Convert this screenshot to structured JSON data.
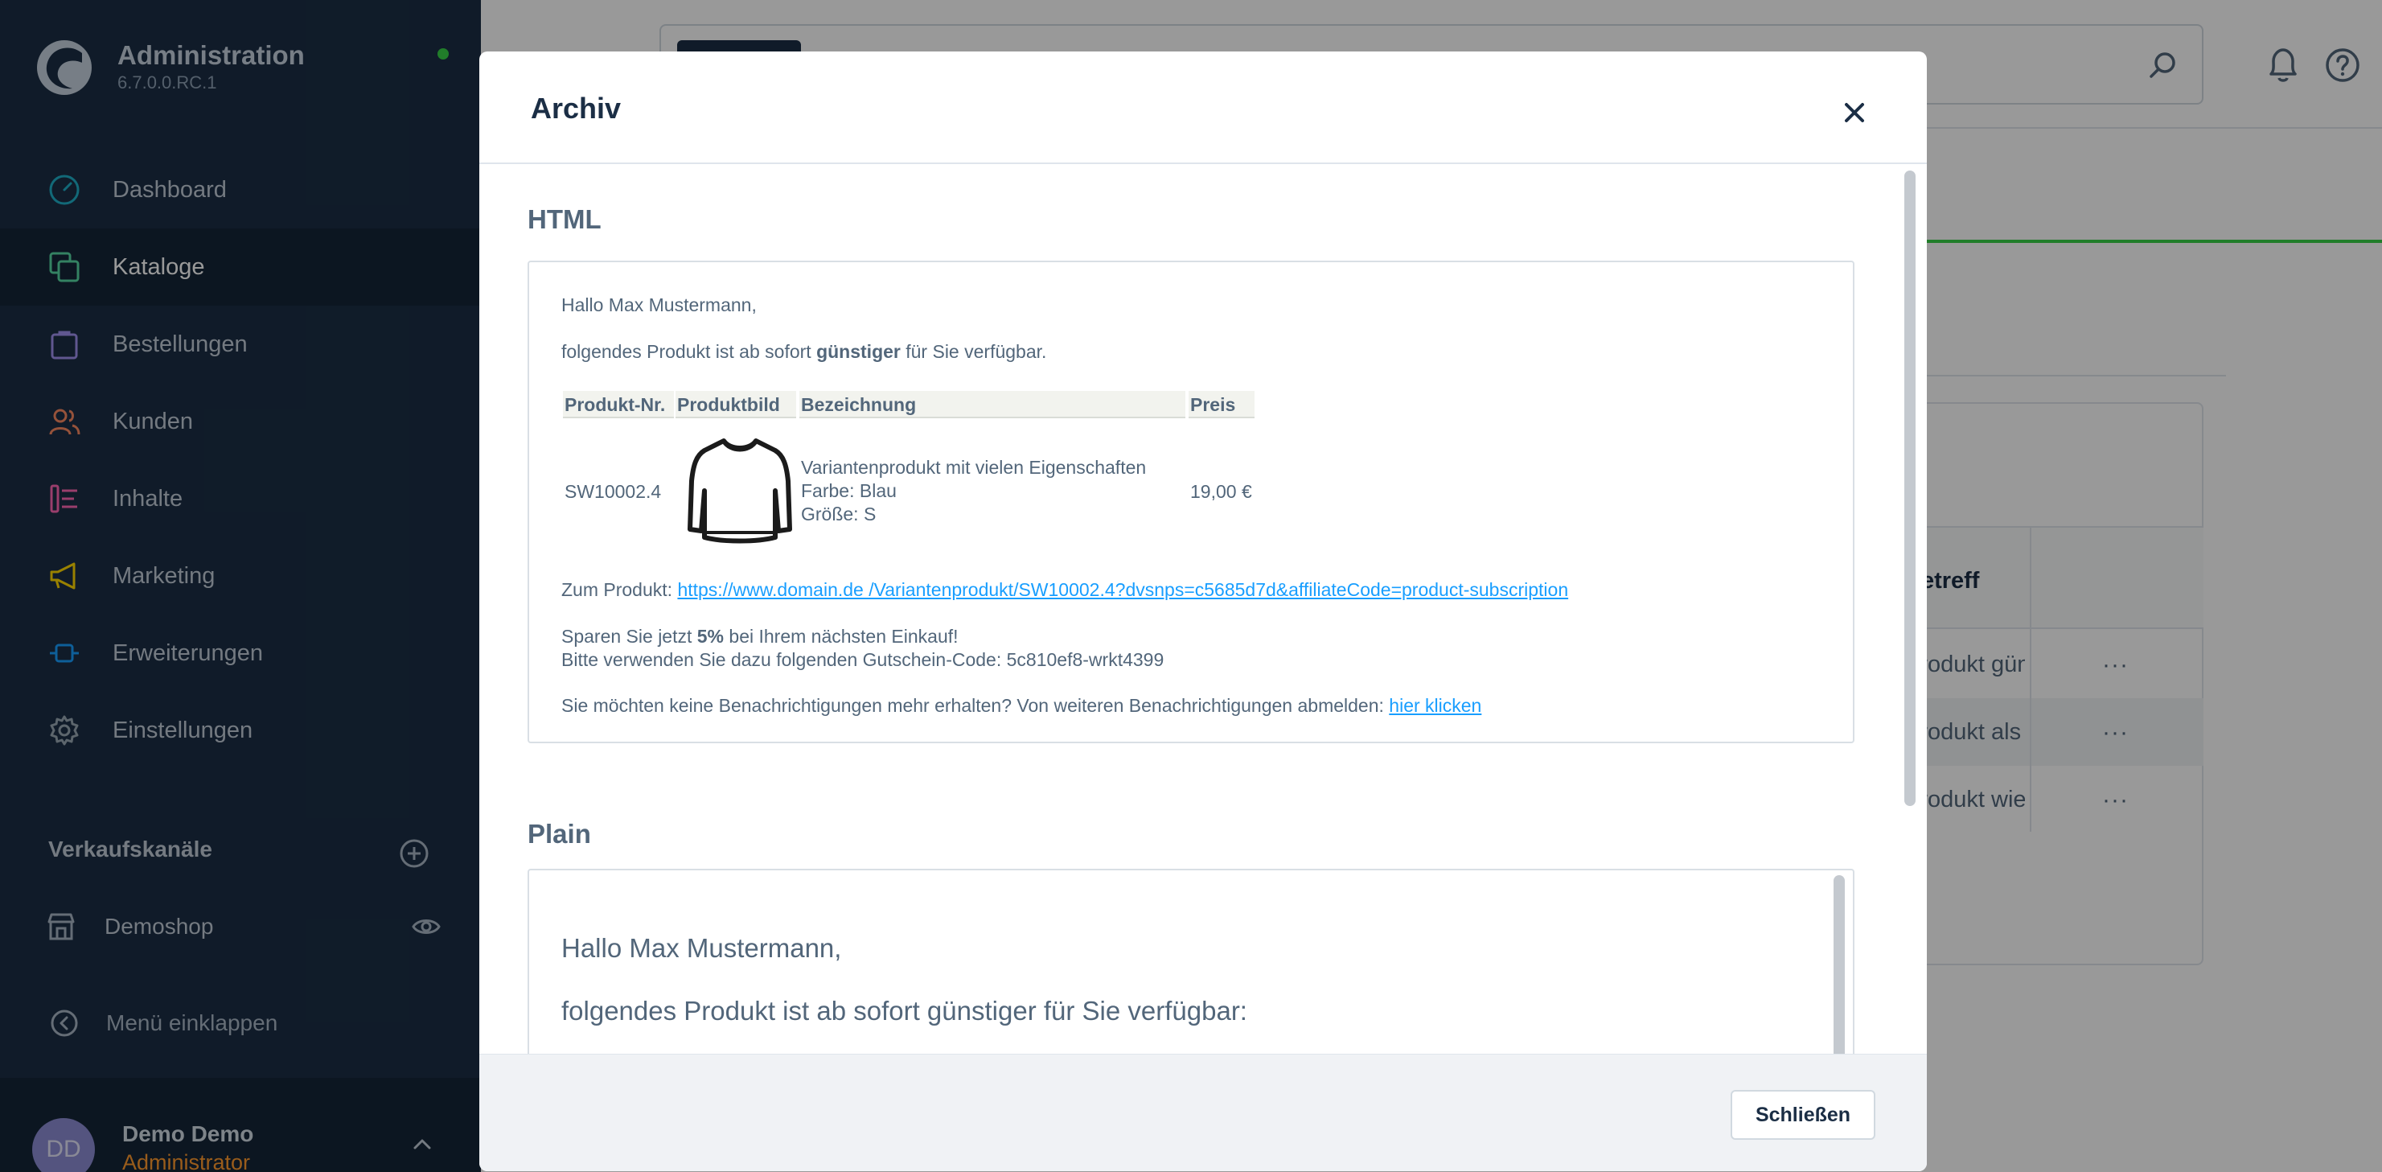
{
  "sidebar": {
    "brand_title": "Administration",
    "brand_version": "6.7.0.0.RC.1",
    "status_color": "#37d046",
    "nav": [
      {
        "label": "Dashboard",
        "icon": "gauge-icon",
        "color": "#1fb0c9"
      },
      {
        "label": "Kataloge",
        "icon": "catalog-icon",
        "color": "#57d9a3",
        "active": true
      },
      {
        "label": "Bestellungen",
        "icon": "shopping-bag-icon",
        "color": "#a092f0"
      },
      {
        "label": "Kunden",
        "icon": "users-icon",
        "color": "#f88962"
      },
      {
        "label": "Inhalte",
        "icon": "content-icon",
        "color": "#ff68b4"
      },
      {
        "label": "Marketing",
        "icon": "megaphone-icon",
        "color": "#ffd700"
      },
      {
        "label": "Erweiterungen",
        "icon": "plug-icon",
        "color": "#189eff"
      },
      {
        "label": "Einstellungen",
        "icon": "gear-icon",
        "color": "#9aa8b5"
      }
    ],
    "channels_title": "Verkaufskanäle",
    "channel_name": "Demoshop",
    "collapse_label": "Menü einklappen",
    "user": {
      "initials": "DD",
      "name": "Demo Demo",
      "role": "Administrator"
    }
  },
  "background": {
    "grid_header": "Betreff",
    "rows": [
      "Produkt gün",
      "Produkt als",
      "Produkt wie"
    ],
    "row_action": "···"
  },
  "modal": {
    "title": "Archiv",
    "html_section": "HTML",
    "plain_section": "Plain",
    "close_button": "Schließen",
    "mail": {
      "greeting": "Hallo Max Mustermann,",
      "intro_before": "folgendes Produkt ist ab sofort ",
      "intro_bold": "günstiger",
      "intro_after": " für Sie verfügbar.",
      "table_headers": [
        "Produkt-Nr.",
        "Produktbild",
        "Bezeichnung",
        "Preis"
      ],
      "product_number": "SW10002.4",
      "product_name": "Variantenprodukt mit vielen Eigenschaften",
      "product_color": "Farbe: Blau",
      "product_size": "Größe: S",
      "product_price": "19,00 €",
      "link_label": "Zum Produkt: ",
      "link_url": "https://www.domain.de /Variantenprodukt/SW10002.4?dvsnps=c5685d7d&affiliateCode=product-subscription",
      "save_before": "Sparen Sie jetzt ",
      "save_bold": "5%",
      "save_after": " bei Ihrem nächsten Einkauf!",
      "voucher": "Bitte verwenden Sie dazu folgenden Gutschein-Code: 5c810ef8-wrkt4399",
      "unsub_text": "Sie möchten keine Benachrichtigungen mehr erhalten? Von weiteren Benachrichtigungen abmelden: ",
      "unsub_link": "hier klicken"
    },
    "plain": {
      "greeting": "Hallo Max Mustermann,",
      "intro": "folgendes Produkt ist ab sofort günstiger für Sie verfügbar:"
    }
  }
}
